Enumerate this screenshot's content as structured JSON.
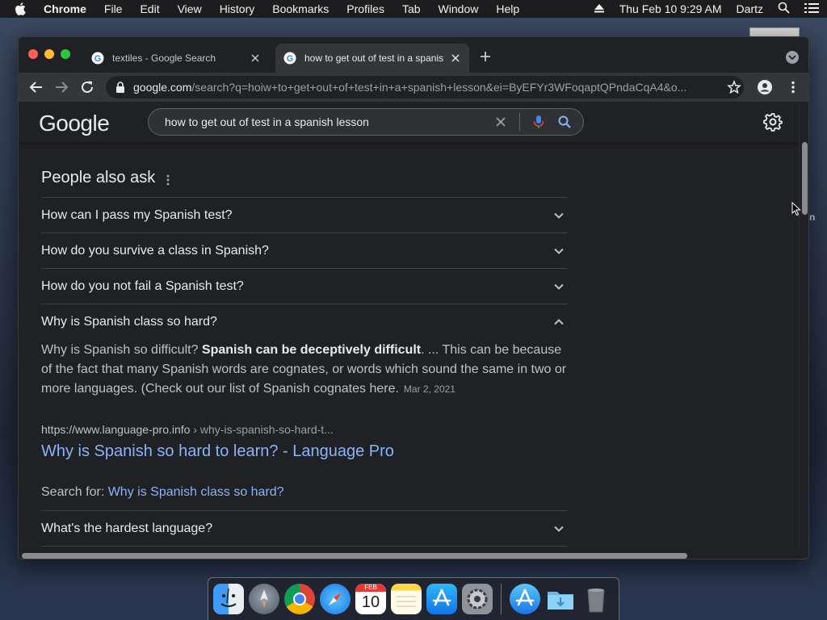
{
  "menubar": {
    "app": "Chrome",
    "items": [
      "File",
      "Edit",
      "View",
      "History",
      "Bookmarks",
      "Profiles",
      "Tab",
      "Window",
      "Help"
    ],
    "clock": "Thu Feb 10  9:29 AM",
    "user": "Dartz"
  },
  "desktop": {
    "edge_text": "n"
  },
  "tabs": [
    {
      "title": "textiles - Google Search",
      "active": false
    },
    {
      "title": "how to get out of test in a spanish lesson",
      "active": true
    }
  ],
  "omnibox": {
    "host": "google.com",
    "path": "/search?q=hoiw+to+get+out+of+test+in+a+spanish+lesson&ei=ByEFYr3WFoqaptQPndaCqA4&o..."
  },
  "google": {
    "logo": "Google",
    "query": "how to get out of test in a spanish lesson"
  },
  "people_also_ask": {
    "title": "People also ask",
    "questions": [
      "How can I pass my Spanish test?",
      "How do you survive a class in Spanish?",
      "How do you not fail a Spanish test?",
      "Why is Spanish class so hard?",
      "What's the hardest language?"
    ],
    "expanded_answer": {
      "text_before": "Why is Spanish so difficult? ",
      "bold": "Spanish can be deceptively difficult",
      "text_after": ". ... This can be because of the fact that many Spanish words are cognates, or words which sound the same in two or more languages. (Check out our list of Spanish cognates here.",
      "date": "Mar 2, 2021",
      "source_url": "https://www.language-pro.info",
      "source_crumb": " › why-is-spanish-so-hard-t...",
      "source_title": "Why is Spanish so hard to learn? - Language Pro",
      "search_for_label": "Search for: ",
      "search_for_link": "Why is Spanish class so hard?"
    }
  },
  "dock": {
    "apps": [
      "finder",
      "launchpad",
      "chrome",
      "safari",
      "calendar",
      "notes",
      "app-store",
      "system-preferences",
      "app-store-alt",
      "downloads",
      "trash"
    ],
    "calendar": {
      "month": "FEB",
      "day": "10"
    }
  },
  "colors": {
    "link": "#8ab4f8",
    "bg": "#202124",
    "toolbar": "#35363a"
  }
}
